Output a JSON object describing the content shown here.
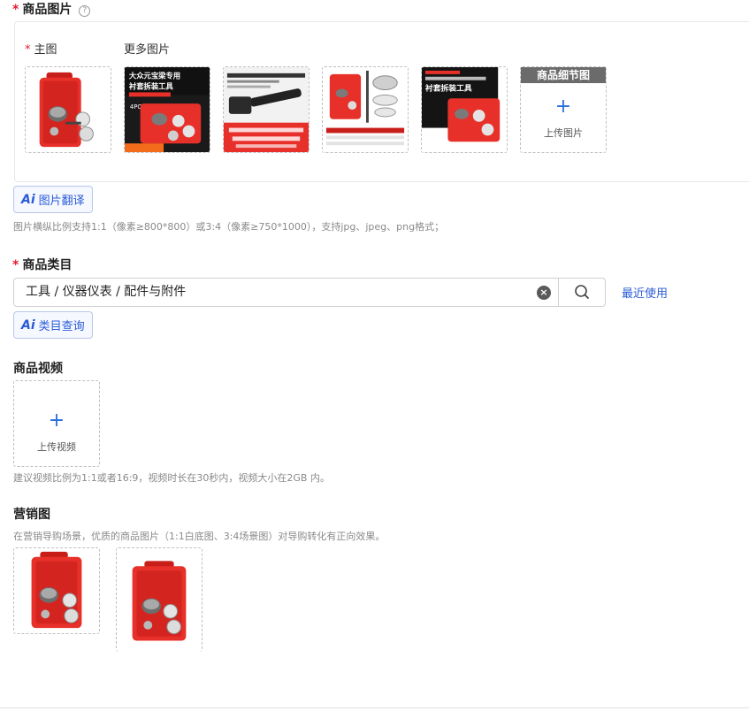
{
  "product_images": {
    "title": "商品图片",
    "help_icon": "question-circle-icon",
    "main_label": "主图",
    "more_label": "更多图片",
    "thumb2_text": {
      "line1": "大众元宝梁专用",
      "line2": "衬套拆装工具",
      "badge": "4PC"
    },
    "thumb5_text": {
      "line1": "衬套拆装工具"
    },
    "detail": {
      "banner": "商品细节图",
      "upload_label": "上传图片"
    },
    "ai_translate": {
      "ai": "Ai",
      "label": "图片翻译"
    },
    "hint": "图片横纵比例支持1:1（像素≥800*800）或3:4（像素≥750*1000），支持jpg、jpeg、png格式；"
  },
  "category": {
    "title": "商品类目",
    "value": "工具 / 仪器仪表 / 配件与附件",
    "recent_label": "最近使用",
    "ai_lookup": {
      "ai": "Ai",
      "label": "类目查询"
    }
  },
  "video": {
    "title": "商品视频",
    "upload_label": "上传视频",
    "hint": "建议视频比例为1:1或者16:9，视频时长在30秒内，视频大小在2GB 内。"
  },
  "marketing": {
    "title": "营销图",
    "hint": "在营销导购场景，优质的商品图片（1:1白底图、3:4场景图）对导购转化有正向效果。"
  },
  "colors": {
    "accent": "#2a5bd7",
    "required": "#e0202f",
    "case_red": "#e8302a"
  }
}
